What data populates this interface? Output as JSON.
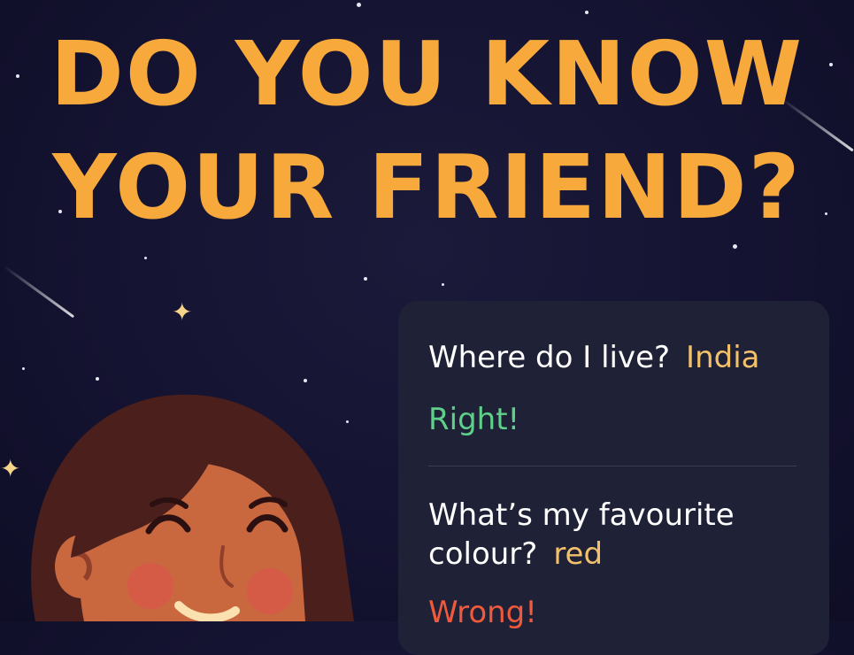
{
  "title": {
    "line1": "DO YOU KNOW",
    "line2": "YOUR FRIEND?"
  },
  "card": {
    "q1": {
      "question": "Where do I live?",
      "answer": "India",
      "result": "Right!"
    },
    "q2": {
      "question_line1": "What’s my favourite",
      "question_line2": "colour?",
      "answer": "red",
      "result": "Wrong!"
    }
  },
  "colors": {
    "background": "#141331",
    "title": "#f7a93b",
    "card": "#1f2137",
    "answer": "#f4c16b",
    "right": "#5fd08a",
    "wrong": "#ef5a3c"
  },
  "icons": [
    "sparkle-icon",
    "shooting-star-icon",
    "girl-illustration"
  ]
}
